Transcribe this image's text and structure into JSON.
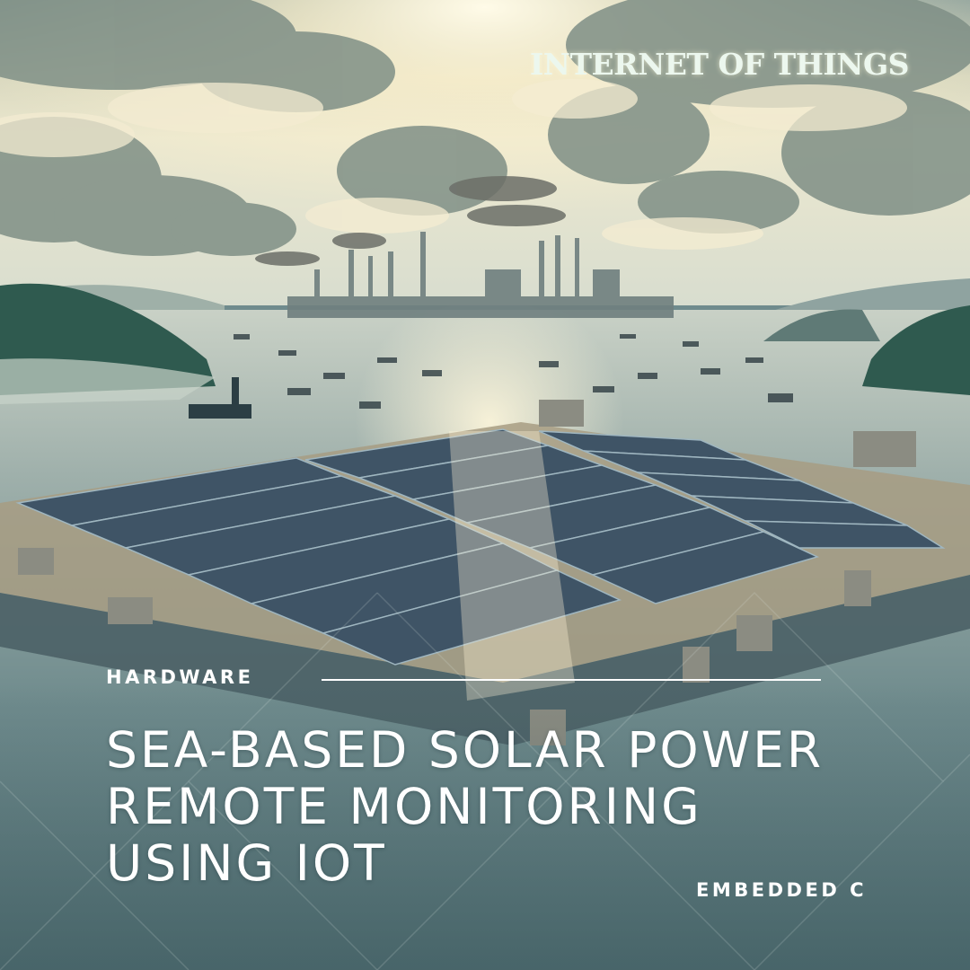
{
  "poster": {
    "category": "INTERNET OF THINGS",
    "tag_primary": "HARDWARE",
    "title_lines": [
      "SEA-BASED SOLAR POWER",
      "REMOTE MONITORING",
      "USING IOT"
    ],
    "tag_secondary": "EMBEDDED C"
  },
  "colors": {
    "sky_top": "#b9c4b6",
    "sun_glow": "#fff6d8",
    "sea": "#6f8b8d",
    "panel": "#3f5466",
    "text": "#ffffff",
    "category_text": "#ecf7ee"
  }
}
